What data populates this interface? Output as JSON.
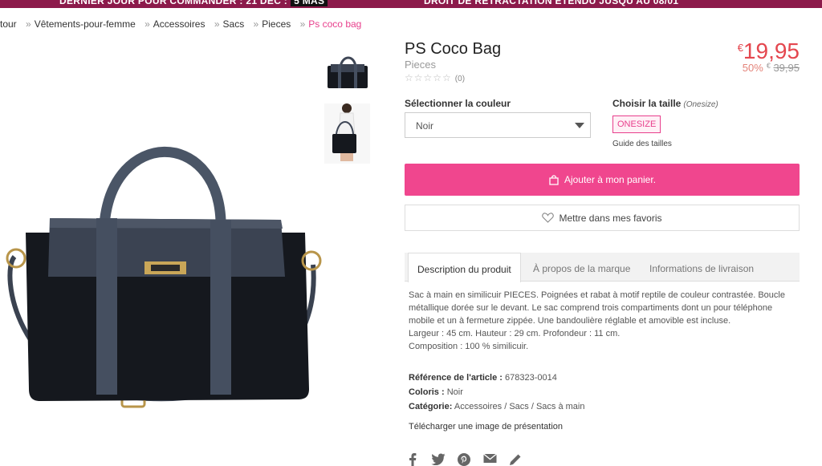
{
  "topbar": {
    "left_text": "DERNIER JOUR POUR COMMANDER : 21 DÉC :",
    "left_badge": "5 MAS",
    "right_text": "DROIT DE RÉTRACTATION ÉTENDU JUSQU'AU 08/01"
  },
  "breadcrumb": [
    "tour",
    "Vêtements-pour-femme",
    "Accessoires",
    "Sacs",
    "Pieces",
    "Ps coco bag"
  ],
  "product": {
    "title": "PS Coco Bag",
    "brand": "Pieces",
    "stars": "☆☆☆☆☆",
    "review_count": "(0)",
    "currency": "€",
    "price": "19,95",
    "discount": "50%",
    "old_currency": "€",
    "old_price": "39,95"
  },
  "color": {
    "label": "Sélectionner la couleur",
    "selected": "Noir"
  },
  "size": {
    "label": "Choisir la taille",
    "sub": "(Onesize)",
    "option": "ONESIZE",
    "guide": "Guide des tailles"
  },
  "actions": {
    "cart": "Ajouter à mon panier.",
    "favorite": "Mettre dans mes favoris"
  },
  "tabs": [
    "Description du produit",
    "À propos de la marque",
    "Informations de livraison"
  ],
  "description": {
    "text": "Sac à main en similicuir PIECES. Poignées et rabat à motif reptile de couleur contrastée. Boucle métallique dorée sur le devant. Le sac comprend trois compartiments dont un pour téléphone mobile et un à fermeture zippée. Une bandoulière réglable et amovible est incluse.",
    "dimensions": "Largeur : 45 cm. Hauteur : 29 cm. Profondeur : 11 cm.",
    "composition": "Composition : 100 % similicuir.",
    "ref_label": "Référence de l'article :",
    "ref_value": "678323-0014",
    "color_label": "Coloris :",
    "color_value": "Noir",
    "category_label": "Catégorie:",
    "category_value": "Accessoires / Sacs / Sacs à main",
    "download": "Télécharger une image de présentation"
  },
  "social_icons": [
    "facebook-icon",
    "twitter-icon",
    "pinterest-icon",
    "email-icon",
    "pencil-icon"
  ],
  "colors": {
    "accent": "#f0468e",
    "price": "#e4474f",
    "topbar": "#8c1a4b"
  }
}
